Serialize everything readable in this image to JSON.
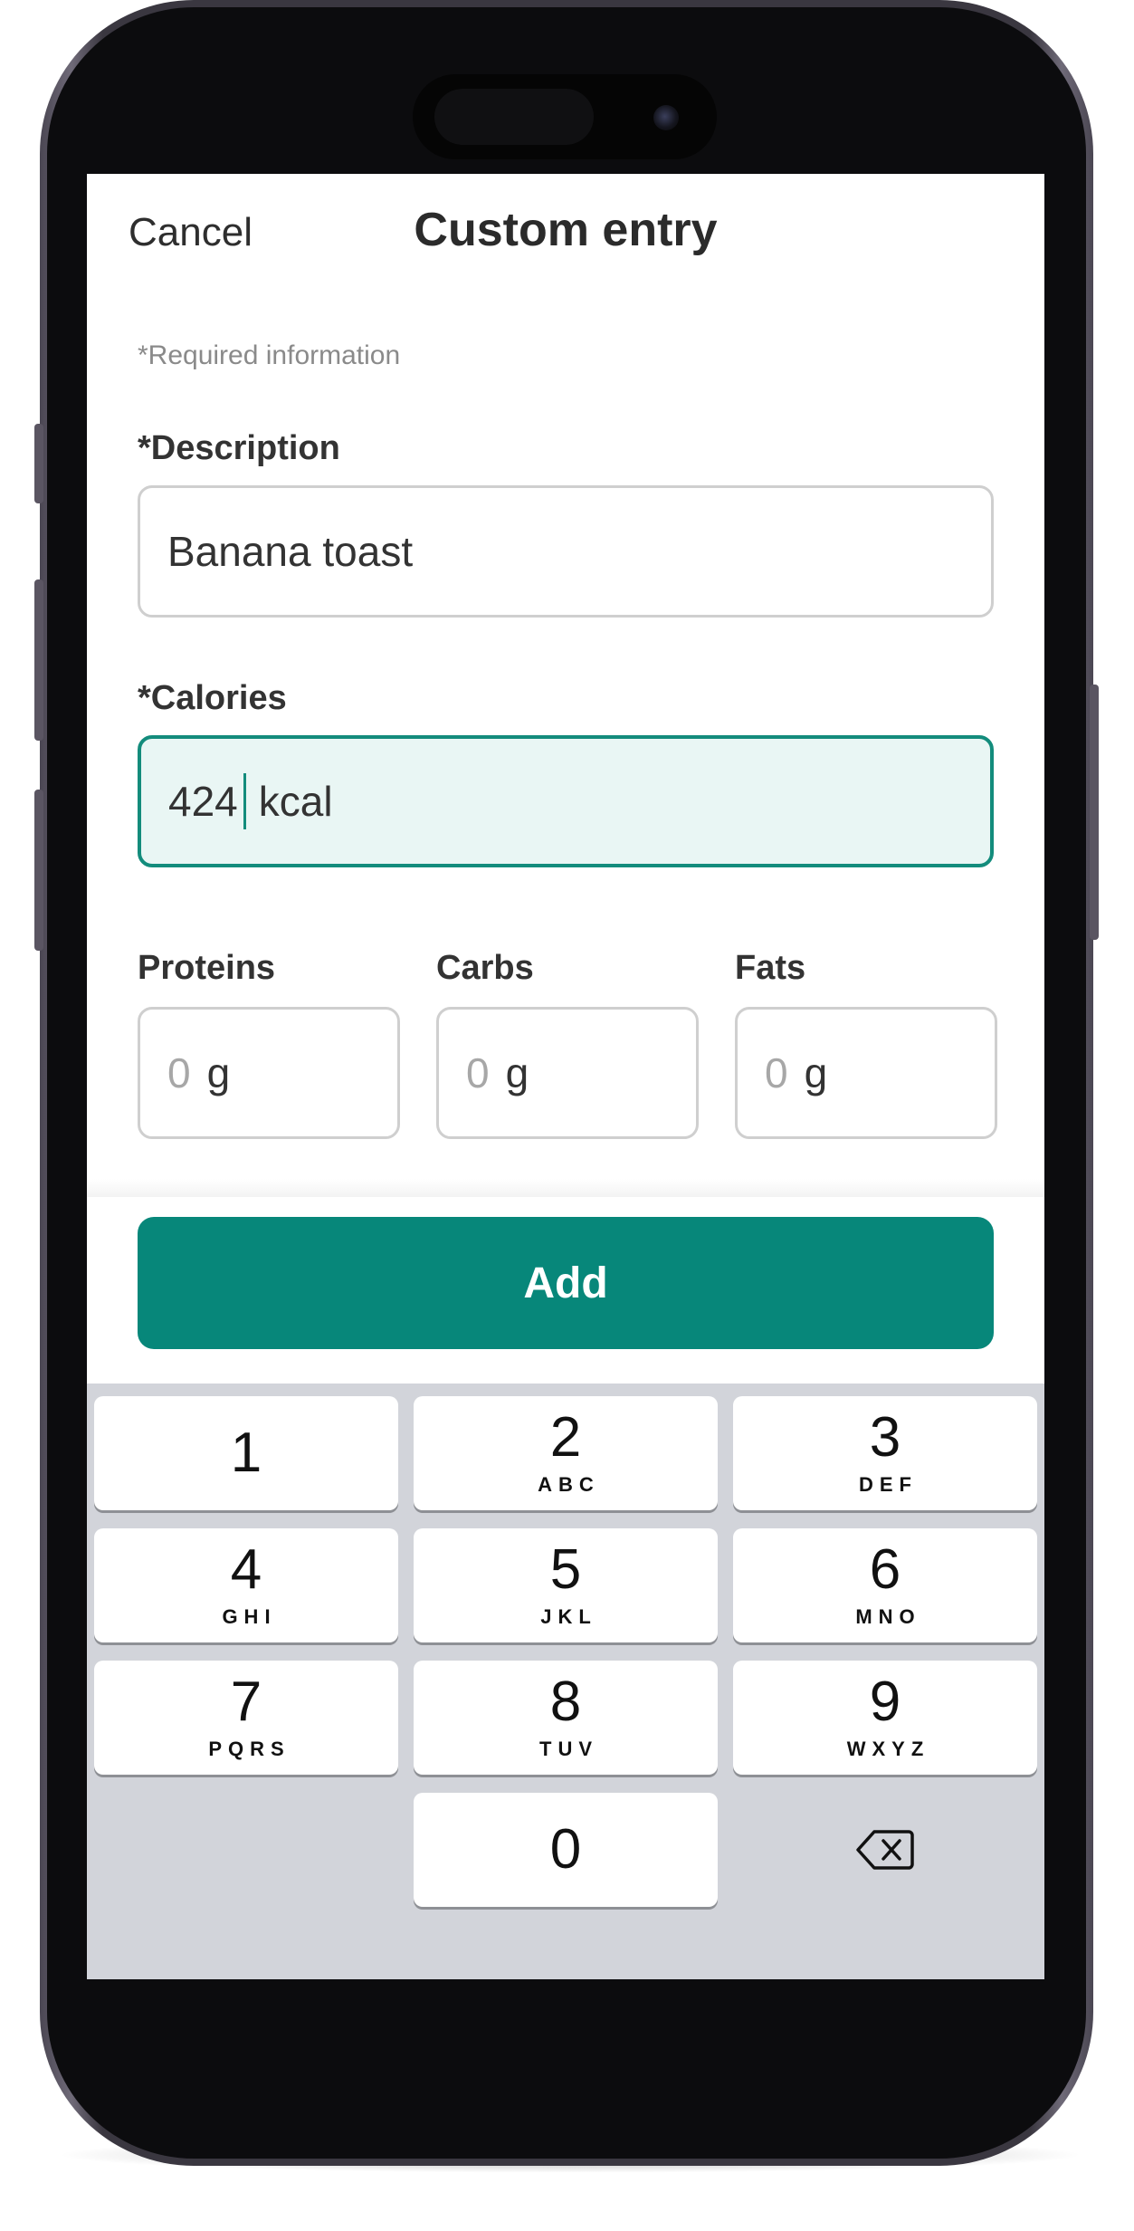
{
  "header": {
    "cancel_label": "Cancel",
    "title": "Custom entry"
  },
  "form": {
    "required_note": "*Required information",
    "description": {
      "label": "*Description",
      "value": "Banana toast"
    },
    "calories": {
      "label": "*Calories",
      "value": "424",
      "unit": "kcal"
    },
    "macros": [
      {
        "label": "Proteins",
        "placeholder": "0",
        "unit": "g"
      },
      {
        "label": "Carbs",
        "placeholder": "0",
        "unit": "g"
      },
      {
        "label": "Fats",
        "placeholder": "0",
        "unit": "g"
      }
    ],
    "add_label": "Add"
  },
  "keypad": {
    "keys": [
      {
        "digit": "1",
        "letters": ""
      },
      {
        "digit": "2",
        "letters": "ABC"
      },
      {
        "digit": "3",
        "letters": "DEF"
      },
      {
        "digit": "4",
        "letters": "GHI"
      },
      {
        "digit": "5",
        "letters": "JKL"
      },
      {
        "digit": "6",
        "letters": "MNO"
      },
      {
        "digit": "7",
        "letters": "PQRS"
      },
      {
        "digit": "8",
        "letters": "TUV"
      },
      {
        "digit": "9",
        "letters": "WXYZ"
      },
      {
        "digit": "0",
        "letters": ""
      }
    ],
    "backspace_icon": "backspace-icon"
  },
  "colors": {
    "accent": "#07877a",
    "focus_border": "#138c7c",
    "focus_fill": "#e9f6f4",
    "keypad_bg": "#d2d4da"
  }
}
